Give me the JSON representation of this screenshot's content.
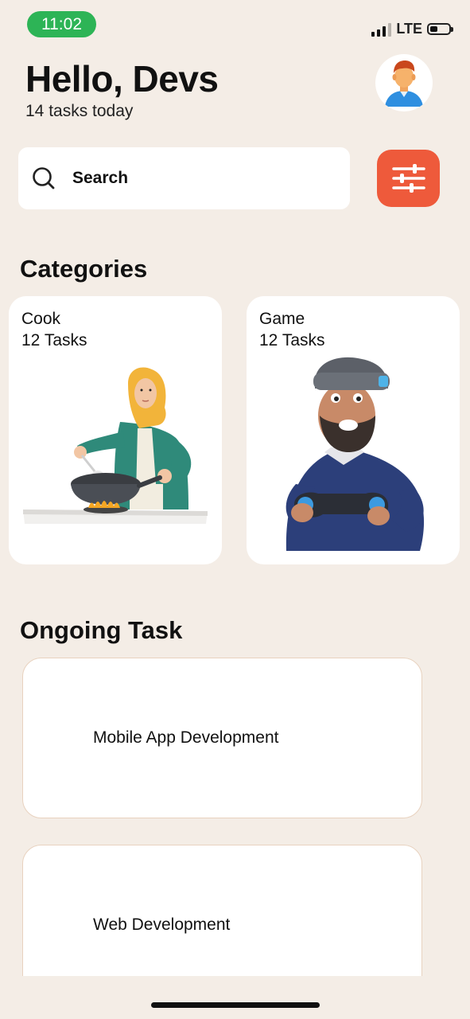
{
  "status_bar": {
    "time": "11:02",
    "network": "LTE"
  },
  "header": {
    "greeting": "Hello, Devs",
    "subtitle": "14 tasks today"
  },
  "search": {
    "placeholder": "Search"
  },
  "categories": {
    "title": "Categories",
    "items": [
      {
        "name": "Cook",
        "count": "12 Tasks",
        "illustration": "cooking-woman-illustration"
      },
      {
        "name": "Game",
        "count": "12 Tasks",
        "illustration": "vr-gamer-illustration"
      }
    ]
  },
  "ongoing": {
    "title": "Ongoing Task",
    "tasks": [
      {
        "label": "Mobile App Development"
      },
      {
        "label": "Web Development"
      }
    ]
  },
  "colors": {
    "accent": "#ee5a3b",
    "background": "#f4ede6",
    "status_green": "#2db456"
  }
}
